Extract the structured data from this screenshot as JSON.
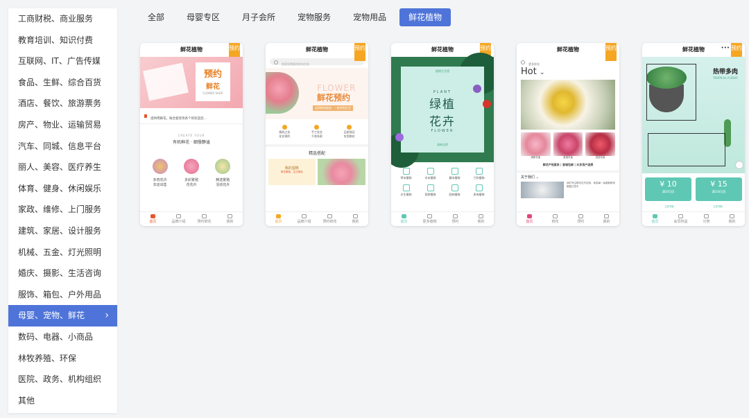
{
  "sidebar": {
    "items": [
      {
        "label": "工商财税、商业服务"
      },
      {
        "label": "教育培训、知识付费"
      },
      {
        "label": "互联网、IT、广告传媒"
      },
      {
        "label": "食品、生鲜、综合百货"
      },
      {
        "label": "酒店、餐饮、旅游票务"
      },
      {
        "label": "房产、物业、运输贸易"
      },
      {
        "label": "汽车、同城、信息平台"
      },
      {
        "label": "丽人、美容、医疗养生"
      },
      {
        "label": "体育、健身、休闲娱乐"
      },
      {
        "label": "家政、维修、上门服务"
      },
      {
        "label": "建筑、家居、设计服务"
      },
      {
        "label": "机械、五金、灯光照明"
      },
      {
        "label": "婚庆、摄影、生活咨询"
      },
      {
        "label": "服饰、箱包、户外用品"
      },
      {
        "label": "母婴、宠物、鲜花"
      },
      {
        "label": "数码、电器、小商品"
      },
      {
        "label": "林牧养殖、环保"
      },
      {
        "label": "医院、政务、机构组织"
      },
      {
        "label": "其他"
      }
    ],
    "active_index": 14,
    "active_chevron": "›"
  },
  "tabs": [
    {
      "label": "全部"
    },
    {
      "label": "母婴专区"
    },
    {
      "label": "月子会所"
    },
    {
      "label": "宠物服务"
    },
    {
      "label": "宠物用品"
    },
    {
      "label": "鲜花植物"
    }
  ],
  "active_tab": 5,
  "colors": {
    "accent": "#4f74d9",
    "ribbon": "#f5a623",
    "pink": "#f7c6c7",
    "mint": "#bfe8dc",
    "teal": "#5fc8b4",
    "orange": "#e4572e"
  },
  "cards": [
    {
      "title": "鲜花植物",
      "badge": "预约",
      "banner_main": "预约",
      "banner_side": "鲜花",
      "banner_sub": "FLOWER SHOP",
      "notice": "提供用鲜花，鲜合套装等各个的欢迎您…",
      "section_en": "CREATE YOUR",
      "section_title": "有机鲜花 · 细慢静谧",
      "products": [
        {
          "name": "多肉花卉",
          "desc": "本店出售"
        },
        {
          "name": "多彩繁殖",
          "desc": "花花卉"
        },
        {
          "name": "精选繁殖",
          "desc": "活动花卉"
        }
      ],
      "nav": [
        "首页",
        "品牌介绍",
        "预约鲜花",
        "我的"
      ]
    },
    {
      "title": "鲜花植物",
      "badge": "预约",
      "search": "搜索您需要的鲜花信息",
      "banner_en": "FLOWER",
      "banner": "鲜花预约",
      "banner_sub": "品质鲜花配送 · 一枝时尚生活",
      "features": [
        {
          "a": "随机之花",
          "b": "花艺预约"
        },
        {
          "a": "手工花艺",
          "b": "千束多款"
        },
        {
          "a": "品质保证",
          "b": "实用鲜花"
        }
      ],
      "section": "精选搭配",
      "promo": "我的蛋糕",
      "promo_sub": "鲜花蛋糕，生日精选",
      "nav": [
        "首页",
        "品牌介绍",
        "预约鲜花",
        "我的"
      ]
    },
    {
      "title": "鲜花植物",
      "badge": "预约",
      "banner_top": "植物生活馆",
      "banner_en": "PLANT",
      "banner_a": "绿植",
      "banner_b": "花卉",
      "banner_en2": "FLOWER",
      "banner_foot": "清新自然",
      "grid": [
        "草本植物",
        "木本植物",
        "藤本植物",
        "兰科植物",
        "水生植物",
        "观赏植物",
        "园林植物",
        "多肉植物"
      ],
      "nav": [
        "首页",
        "更多植物",
        "预约",
        "我的"
      ]
    },
    {
      "title": "鲜花植物",
      "badge": "预约",
      "search": "更多鲜花",
      "hot": "Hot",
      "hot_arrow": "⌄",
      "thumbs": [
        {
          "name": "清新花束"
        },
        {
          "name": "浪漫花束"
        },
        {
          "name": "送给花束"
        }
      ],
      "tagline": "鲜花产地直采 | 冒城包邮 | 众多用户选择",
      "about": "关于我们",
      "about_text": "我们专注鲜花花卉定制，承诺每一朵都新鲜采摘直达您手",
      "nav": [
        "首页",
        "鲜花",
        "预约",
        "我的"
      ]
    },
    {
      "title": "鲜花植物",
      "badge": "预约",
      "menu": "•••",
      "banner": "热带多肉",
      "banner_en": "TROPICAL FLESHY",
      "coupons": [
        {
          "value": "10",
          "desc": "满50可用"
        },
        {
          "value": "15",
          "desc": "满100可用"
        }
      ],
      "coupon_note": "立即领取",
      "nav": [
        "首页",
        "会员权益",
        "分类",
        "我的"
      ]
    }
  ]
}
